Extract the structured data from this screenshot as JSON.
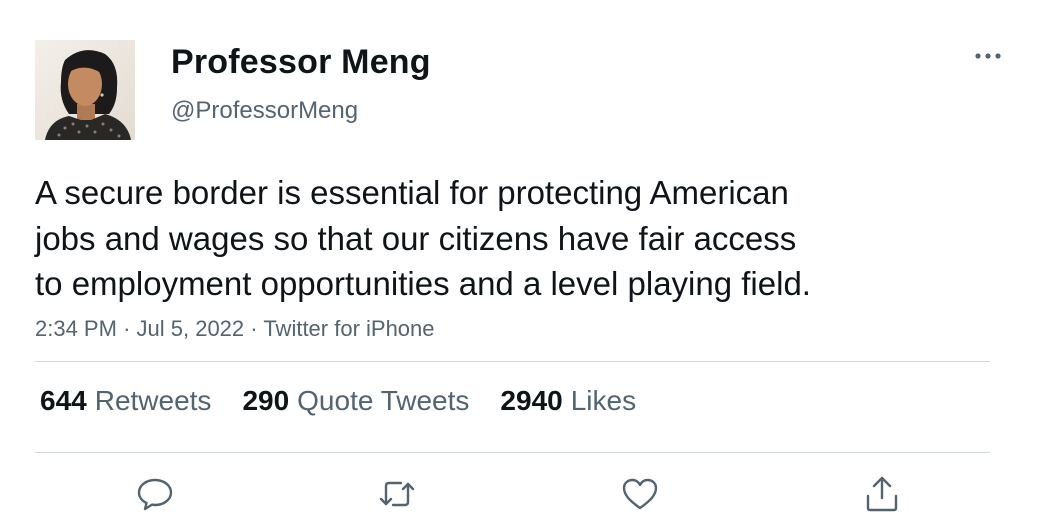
{
  "author": {
    "display_name": "Professor Meng",
    "handle": "@ProfessorMeng"
  },
  "tweet": {
    "text_lines": [
      "A secure border is essential for protecting American",
      "jobs and wages so that our citizens have fair access",
      "to employment opportunities and a level playing field."
    ],
    "time": "2:34 PM",
    "separator": "·",
    "date": "Jul 5, 2022",
    "source": "Twitter for iPhone"
  },
  "stats": {
    "retweets": {
      "count": "644",
      "label": "Retweets"
    },
    "quote_tweets": {
      "count": "290",
      "label": "Quote Tweets"
    },
    "likes": {
      "count": "2940",
      "label": "Likes"
    }
  },
  "icons": {
    "more": "more-horizontal-icon",
    "reply": "reply-icon",
    "retweet": "retweet-icon",
    "like": "heart-icon",
    "share": "share-icon"
  },
  "colors": {
    "text_primary": "#0f1419",
    "text_secondary": "#536471",
    "divider": "#cfd9de"
  }
}
